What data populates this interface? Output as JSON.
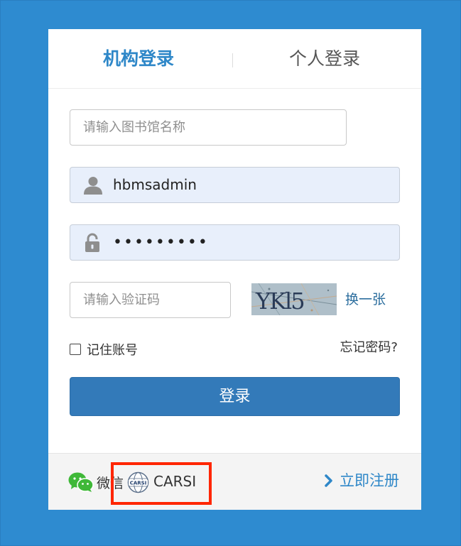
{
  "tabs": {
    "org_login": "机构登录",
    "personal_login": "个人登录"
  },
  "form": {
    "library_placeholder": "请输入图书馆名称",
    "username_value": "hbmsadmin",
    "password_masked": "•••••••••",
    "captcha_placeholder": "请输入验证码",
    "captcha_text": "YKl5",
    "refresh_label": "换一张",
    "remember_label": "记住账号",
    "forgot_label": "忘记密码?",
    "login_label": "登录"
  },
  "footer": {
    "wechat_label": "微信",
    "carsi_logo_text": "CARSI",
    "carsi_label": "CARSI",
    "register_label": "立即注册"
  },
  "colors": {
    "background": "#2e8bd0",
    "accent": "#2e87c8",
    "button": "#337ab9",
    "filled_input": "#e8effb",
    "highlight": "#ff2600",
    "wechat_green": "#3fb838"
  },
  "icons": {
    "username": "user-icon",
    "password": "lock-icon",
    "wechat": "wechat-icon",
    "carsi": "carsi-logo-icon",
    "register": "chevron-right-icon"
  }
}
